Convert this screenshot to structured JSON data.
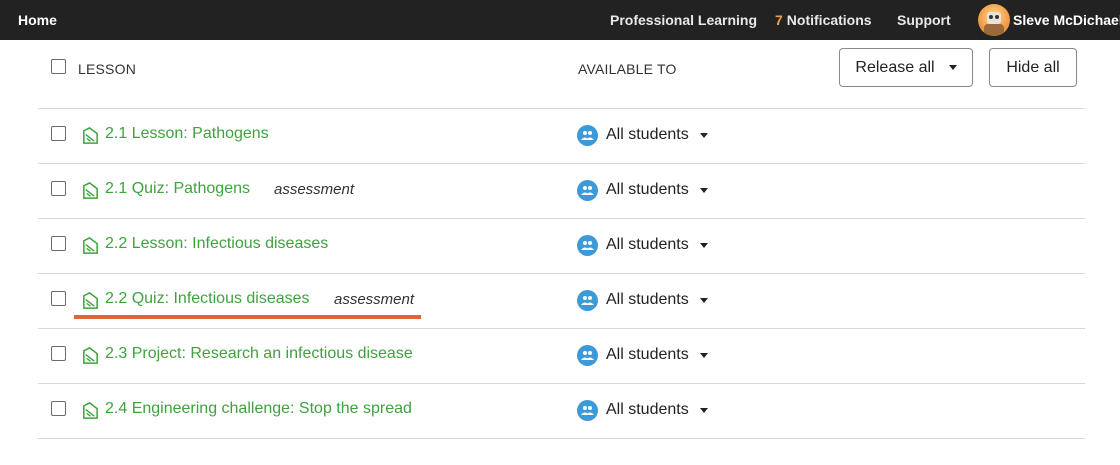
{
  "topbar": {
    "home": "Home",
    "professional_learning": "Professional Learning",
    "notifications_count": "7",
    "notifications_label": "Notifications",
    "support": "Support",
    "user_name": "Sleve McDichael"
  },
  "header": {
    "lesson_col": "LESSON",
    "available_col": "AVAILABLE TO",
    "release_all": "Release all",
    "hide_all": "Hide all"
  },
  "rows": [
    {
      "title": "2.1 Lesson: Pathogens",
      "tag": "",
      "available_to": "All students"
    },
    {
      "title": "2.1 Quiz: Pathogens",
      "tag": "assessment",
      "available_to": "All students"
    },
    {
      "title": "2.2 Lesson: Infectious diseases",
      "tag": "",
      "available_to": "All students"
    },
    {
      "title": "2.2 Quiz: Infectious diseases",
      "tag": "assessment",
      "available_to": "All students"
    },
    {
      "title": "2.3 Project: Research an infectious disease",
      "tag": "",
      "available_to": "All students"
    },
    {
      "title": "2.4 Engineering challenge: Stop the spread",
      "tag": "",
      "available_to": "All students"
    }
  ],
  "colors": {
    "link_green": "#3ea33e",
    "group_blue": "#3c9ad8",
    "highlight_red": "#e4603f",
    "topbar_bg": "#222222"
  }
}
